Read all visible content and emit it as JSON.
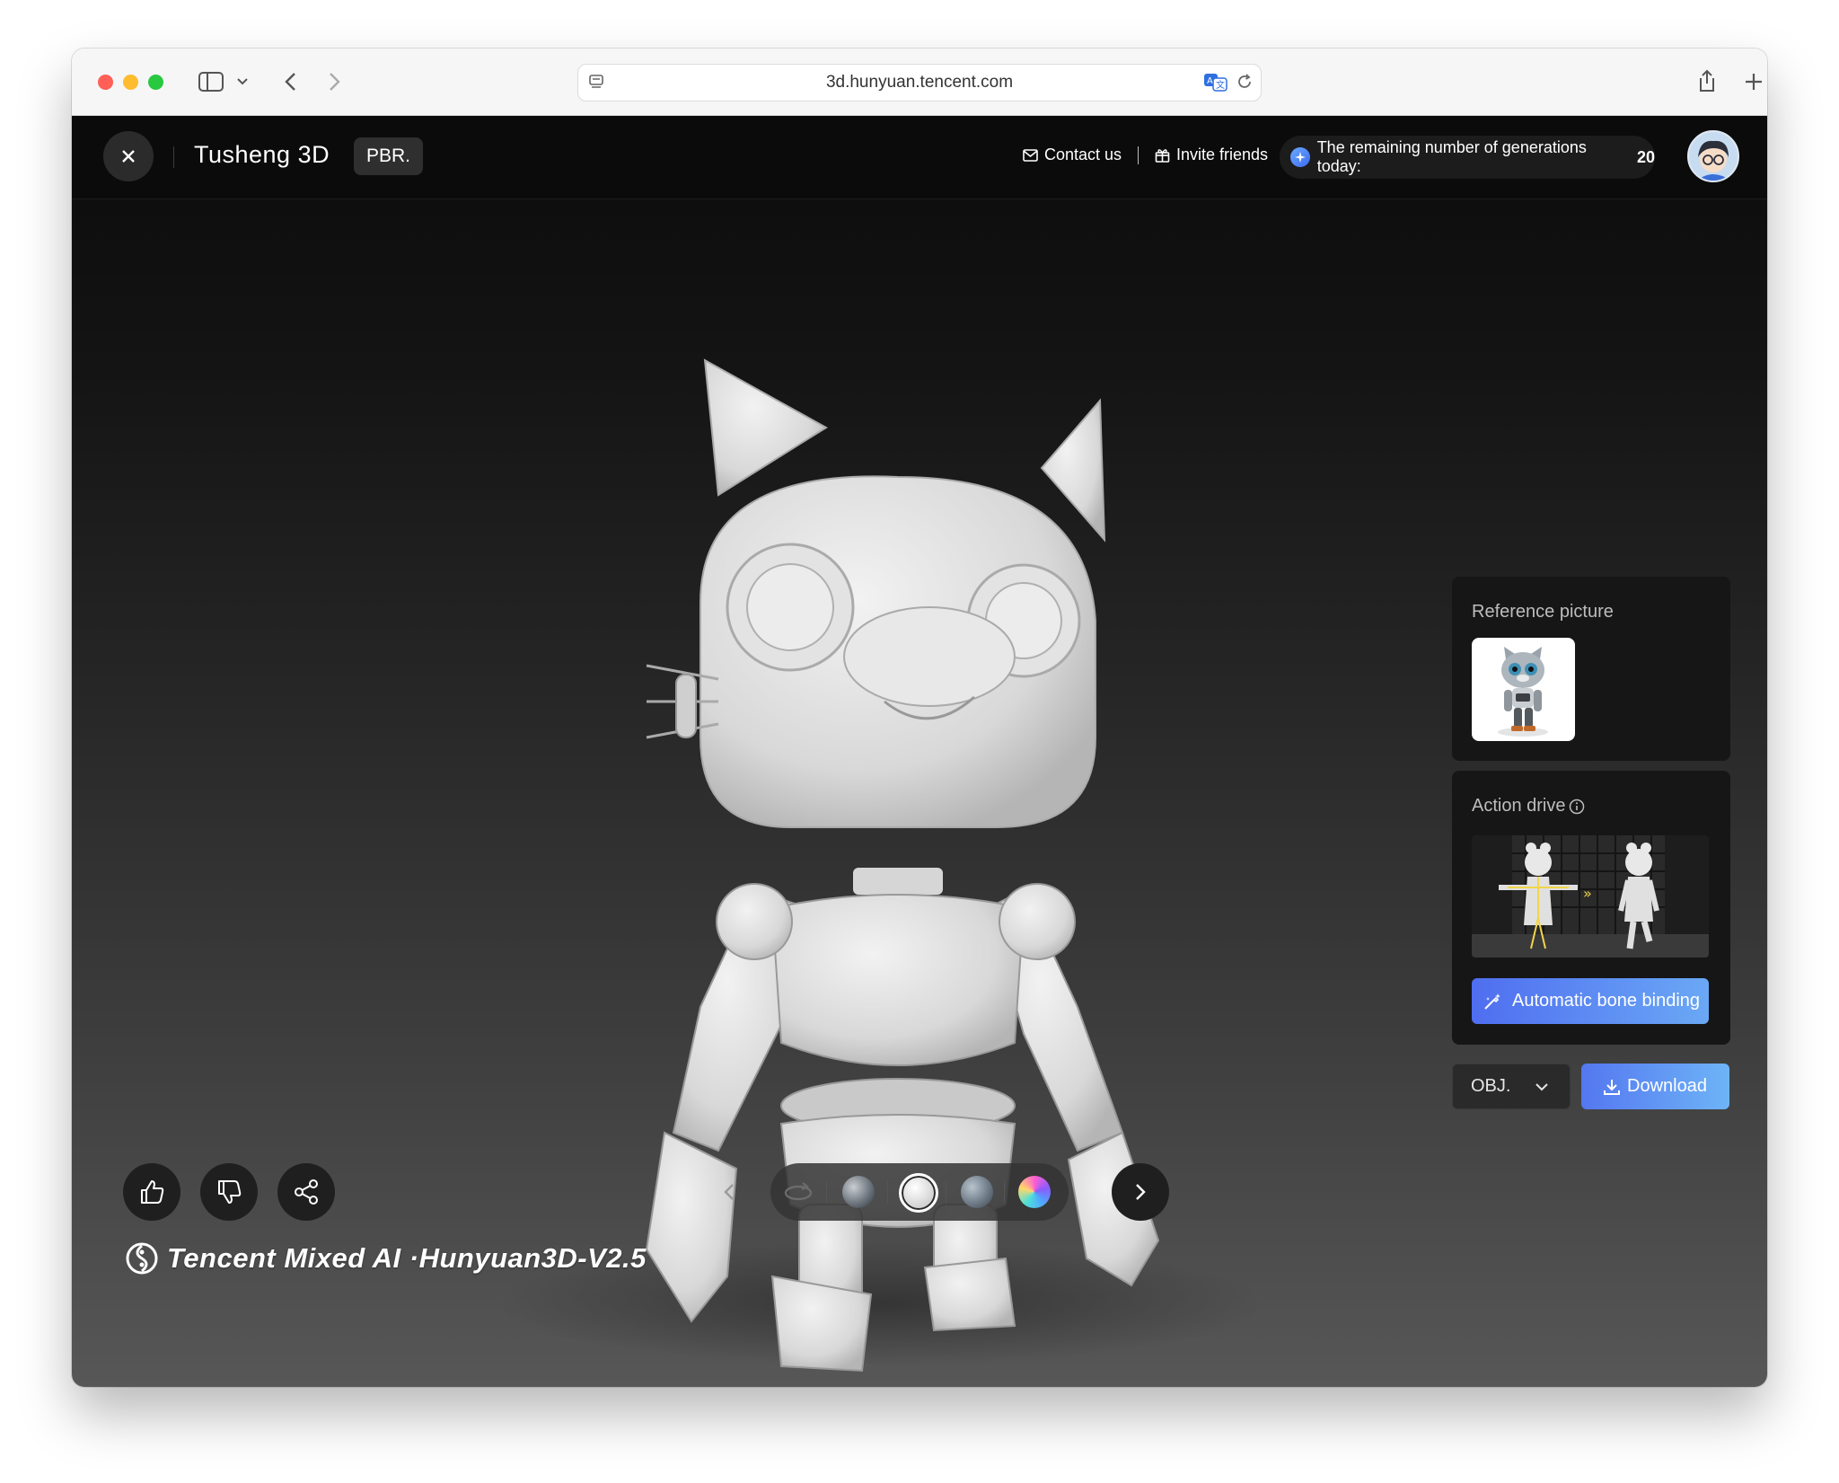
{
  "browser": {
    "url": "3d.hunyuan.tencent.com",
    "icons": [
      "sidebar-icon",
      "chevron-down-icon",
      "back-icon",
      "forward-icon",
      "page-info-icon",
      "translate-icon",
      "reload-icon",
      "share-icon",
      "new-tab-icon",
      "tabs-overview-icon"
    ]
  },
  "header": {
    "title": "Tusheng 3D",
    "badge": "PBR.",
    "contact_label": "Contact us",
    "invite_label": "Invite friends",
    "generations_label": "The remaining number of generations today:",
    "generations_count": "20"
  },
  "reference_panel": {
    "title": "Reference picture"
  },
  "action_panel": {
    "title": "Action drive",
    "bone_button_label": "Automatic bone binding"
  },
  "export": {
    "format": "OBJ.",
    "download_label": "Download"
  },
  "toolbar": {
    "icons": [
      "thumbs-up-icon",
      "thumbs-down-icon",
      "share-icon",
      "chevron-left-icon",
      "chevron-right-icon"
    ],
    "material_modes": [
      "rotate",
      "textured-material",
      "white-clay",
      "noise-material",
      "rainbow-normal"
    ],
    "selected_material": "white-clay"
  },
  "watermark": {
    "text": "Tencent Mixed AI ·Hunyuan3D-V2.5"
  },
  "colors": {
    "accent": "#4f6ef0",
    "background": "#0b0b0b",
    "panel": "#161616",
    "traffic_red": "#ff5f57",
    "traffic_yellow": "#febc2e",
    "traffic_green": "#28c840"
  }
}
